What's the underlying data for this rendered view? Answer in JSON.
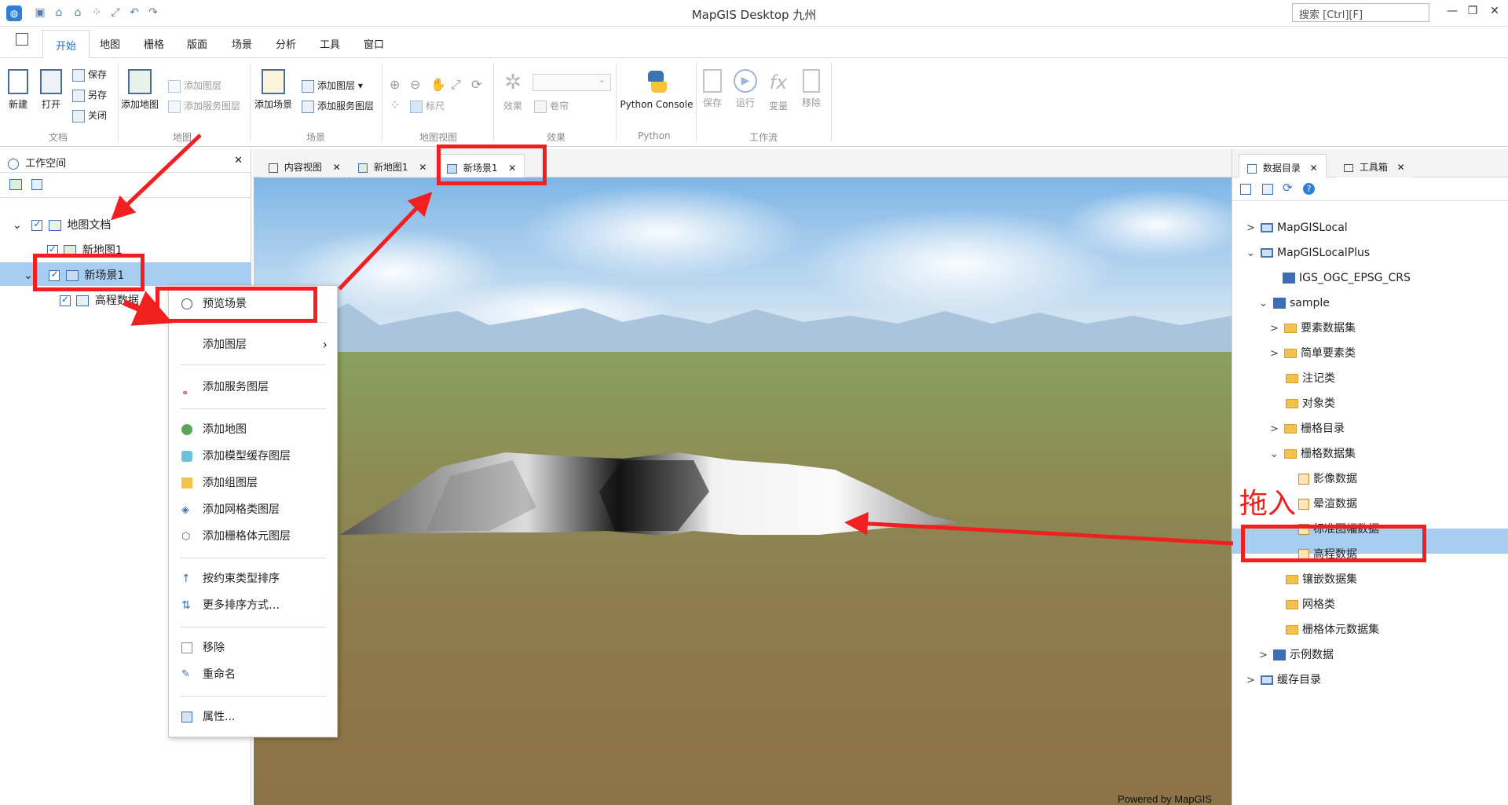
{
  "app": {
    "title": "MapGIS Desktop 九州",
    "search_placeholder": "搜索  [Ctrl][F]"
  },
  "menu_tabs": [
    "开始",
    "地图",
    "栅格",
    "版面",
    "场景",
    "分析",
    "工具",
    "窗口"
  ],
  "ribbon": {
    "file": {
      "new": "新建",
      "open": "打开",
      "save": "保存",
      "save_as": "另存",
      "close": "关闭",
      "group": "文档"
    },
    "map": {
      "add_map": "添加地图",
      "add_layer": "添加图层",
      "add_service_layer": "添加服务图层",
      "group": "地图"
    },
    "scene": {
      "add_scene": "添加场景",
      "add_layer": "添加图层",
      "add_service_layer": "添加服务图层",
      "group": "场景"
    },
    "view": {
      "scale": "标尺",
      "group": "地图视图"
    },
    "effect": {
      "effect": "效果",
      "roller": "卷帘",
      "group": "效果"
    },
    "python": {
      "console": "Python Console",
      "group": "Python"
    },
    "workflow": {
      "save": "保存",
      "run": "运行",
      "variable": "变量",
      "remove": "移除",
      "group": "工作流"
    }
  },
  "left_panel": {
    "title": "工作空间",
    "tree": {
      "root": "地图文档",
      "map1": "新地图1",
      "scene1": "新场景1",
      "elevation": "高程数据"
    }
  },
  "doc_tabs": [
    "内容视图",
    "新地图1",
    "新场景1"
  ],
  "viewport": {
    "credit": "Powered by MapGIS"
  },
  "context_menu": {
    "items": [
      "预览场景",
      "添加图层",
      "添加服务图层",
      "添加地图",
      "添加模型缓存图层",
      "添加组图层",
      "添加网格类图层",
      "添加栅格体元图层",
      "按约束类型排序",
      "更多排序方式…",
      "移除",
      "重命名",
      "属性..."
    ]
  },
  "right_panel": {
    "tabs": [
      "数据目录",
      "工具箱"
    ],
    "tree": [
      {
        "label": "MapGISLocal",
        "icon": "pc"
      },
      {
        "label": "MapGISLocalPlus",
        "icon": "pc"
      },
      {
        "label": "IGS_OGC_EPSG_CRS",
        "icon": "db"
      },
      {
        "label": "sample",
        "icon": "db"
      },
      {
        "label": "要素数据集",
        "icon": "folder"
      },
      {
        "label": "简单要素类",
        "icon": "folder"
      },
      {
        "label": "注记类",
        "icon": "folder"
      },
      {
        "label": "对象类",
        "icon": "folder"
      },
      {
        "label": "栅格目录",
        "icon": "folder"
      },
      {
        "label": "栅格数据集",
        "icon": "folder"
      },
      {
        "label": "影像数据",
        "icon": "raster"
      },
      {
        "label": "晕渲数据",
        "icon": "raster"
      },
      {
        "label": "标准图幅数据",
        "icon": "raster"
      },
      {
        "label": "高程数据",
        "icon": "raster"
      },
      {
        "label": "镶嵌数据集",
        "icon": "folder"
      },
      {
        "label": "网格类",
        "icon": "folder"
      },
      {
        "label": "栅格体元数据集",
        "icon": "folder"
      },
      {
        "label": "示例数据",
        "icon": "db"
      },
      {
        "label": "缓存目录",
        "icon": "pc"
      }
    ]
  },
  "annotation": {
    "drag_in": "拖入"
  },
  "colors": {
    "accent": "#1e70c8",
    "highlight": "#a8cdf2",
    "annotation": "#f02020"
  }
}
